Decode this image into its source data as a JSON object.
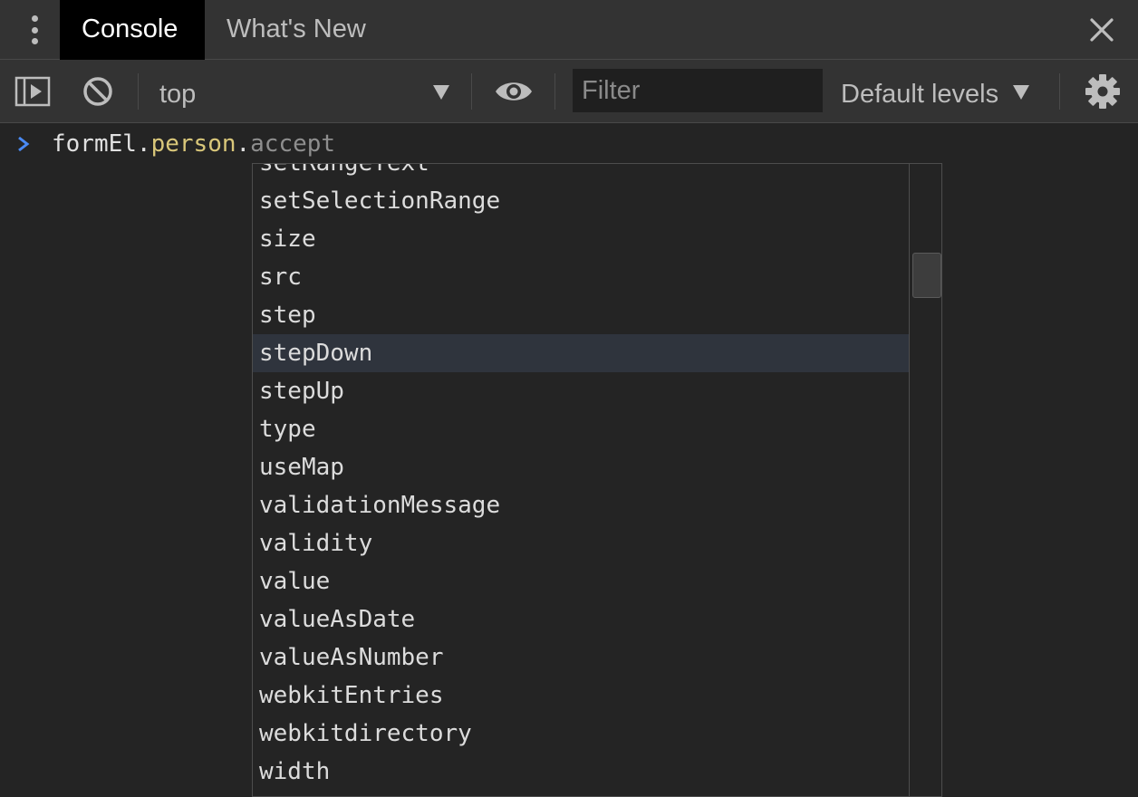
{
  "tabs": [
    {
      "label": "Console",
      "active": true
    },
    {
      "label": "What's New",
      "active": false
    }
  ],
  "toolbar": {
    "context": "top",
    "filter_placeholder": "Filter",
    "levels": "Default levels"
  },
  "console": {
    "input_object": "formEl",
    "input_property": "person",
    "input_hint": "accept"
  },
  "autocomplete": {
    "items": [
      "setRangeText",
      "setSelectionRange",
      "size",
      "src",
      "step",
      "stepDown",
      "stepUp",
      "type",
      "useMap",
      "validationMessage",
      "validity",
      "value",
      "valueAsDate",
      "valueAsNumber",
      "webkitEntries",
      "webkitdirectory",
      "width"
    ],
    "selected": "stepDown",
    "scroll_fraction": 0.15
  },
  "colors": {
    "background": "#242424",
    "toolbar": "#333333",
    "active_tab": "#000000",
    "prompt_accent": "#4a8af4",
    "property": "#d9c77a",
    "hint": "#8e8e8e",
    "selected_row": "#2f343d"
  },
  "icons": [
    "menu-dots-icon",
    "close-icon",
    "sidebar-toggle-icon",
    "clear-console-icon",
    "caret-down-icon",
    "eye-icon",
    "gear-icon",
    "prompt-chevron-icon"
  ]
}
